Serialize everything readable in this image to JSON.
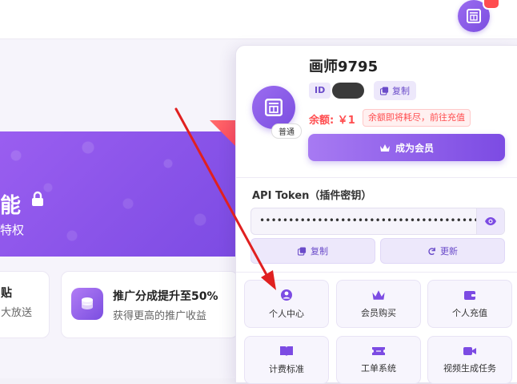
{
  "background_page": {
    "banner": {
      "title_fragment": "能",
      "subtitle_fragment": "特权"
    },
    "feature_cards": [
      {
        "title": "贴",
        "subtitle": "大放送"
      },
      {
        "title": "推广分成提升至50%",
        "subtitle": "获得更高的推广收益"
      }
    ]
  },
  "profile": {
    "username": "画师9795",
    "level": "普通",
    "id_label": "ID",
    "copy_id_label": "复制",
    "balance_text": "余额: ￥1",
    "balance_warning": "余额即将耗尽，前往充值",
    "vip_button_label": "成为会员"
  },
  "api_token": {
    "label": "API Token（插件密钥）",
    "masked_value": "••••••••••••••••••••••••••••••••••••••••",
    "copy_label": "复制",
    "refresh_label": "更新"
  },
  "menu_grid": [
    {
      "label": "个人中心",
      "icon": "user-circle-icon"
    },
    {
      "label": "会员购买",
      "icon": "crown-icon"
    },
    {
      "label": "个人充值",
      "icon": "wallet-icon"
    },
    {
      "label": "计费标准",
      "icon": "book-icon"
    },
    {
      "label": "工单系统",
      "icon": "ticket-icon"
    },
    {
      "label": "视频生成任务",
      "icon": "video-icon"
    }
  ],
  "colors": {
    "accent": "#7c4be3",
    "accent_light": "#ede8fb",
    "danger": "#ff4d4f",
    "annotation_arrow": "#e02020"
  }
}
